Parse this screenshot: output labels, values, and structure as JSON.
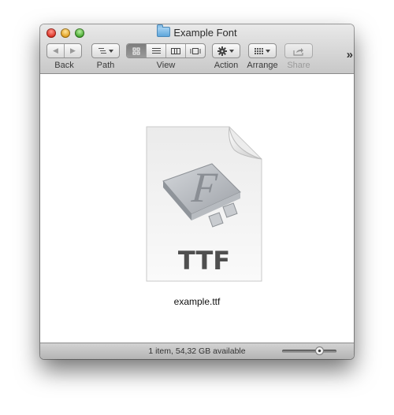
{
  "window": {
    "title": "Example Font",
    "title_icon": "folder-icon"
  },
  "toolbar": {
    "back_label": "Back",
    "back_glyph": "◀",
    "forward_glyph": "▶",
    "path_label": "Path",
    "view_label": "View",
    "action_label": "Action",
    "arrange_label": "Arrange",
    "share_label": "Share",
    "overflow_glyph": "»",
    "view_modes": [
      {
        "name": "icon-view",
        "active": true
      },
      {
        "name": "list-view",
        "active": false
      },
      {
        "name": "column-view",
        "active": false
      },
      {
        "name": "cover-flow-view",
        "active": false
      }
    ],
    "share_enabled": false
  },
  "content": {
    "file": {
      "name": "example.ttf",
      "icon_text": "TTF",
      "icon_letter": "F",
      "icon_type": "font-file-icon"
    }
  },
  "statusbar": {
    "text": "1 item, 54,32 GB available",
    "icon_size_slider_fraction": 0.68
  }
}
